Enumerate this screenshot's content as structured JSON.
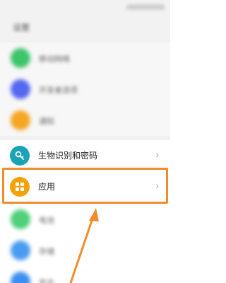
{
  "header": {
    "title": "设置"
  },
  "blurred_items": [
    {
      "label": "移动网络",
      "color": "#3ec46b"
    },
    {
      "label": "开发者选项",
      "color": "#5468f0"
    },
    {
      "label": "通知",
      "color": "#f5a623"
    }
  ],
  "items": [
    {
      "label": "生物识别和密码",
      "color": "#1aa3b6",
      "icon": "key-icon"
    },
    {
      "label": "应用",
      "color": "#f5a10a",
      "icon": "apps-grid-icon"
    }
  ],
  "lower_blurred_items": [
    {
      "label": "电池",
      "color": "#4fd07a"
    },
    {
      "label": "存储",
      "color": "#4a9cf0"
    },
    {
      "label": "安全",
      "color": "#3b8ff0"
    }
  ],
  "colors": {
    "highlight": "#f08c2a",
    "arrow": "#f08c2a"
  },
  "chevron": "›"
}
